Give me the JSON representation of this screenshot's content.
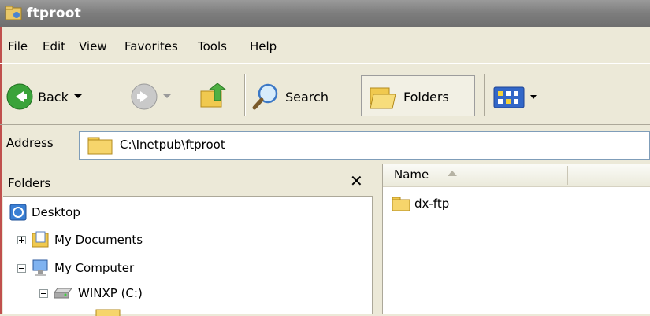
{
  "window": {
    "title": "ftproot"
  },
  "menu": [
    {
      "label": "File"
    },
    {
      "label": "Edit"
    },
    {
      "label": "View"
    },
    {
      "label": "Favorites"
    },
    {
      "label": "Tools"
    },
    {
      "label": "Help"
    }
  ],
  "toolbar": {
    "back_label": "Back",
    "search_label": "Search",
    "folders_label": "Folders"
  },
  "address": {
    "label": "Address",
    "value": "C:\\Inetpub\\ftproot"
  },
  "folders_pane": {
    "title": "Folders",
    "tree": [
      {
        "label": "Desktop"
      },
      {
        "label": "My Documents"
      },
      {
        "label": "My Computer"
      },
      {
        "label": "WINXP (C:)"
      }
    ]
  },
  "file_list": {
    "columns": [
      "Name"
    ],
    "items": [
      {
        "name": "dx-ftp"
      }
    ]
  },
  "colors": {
    "accent": "#316ac5",
    "folder": "#f6d56b",
    "title_bg": "#7d7d7d"
  }
}
